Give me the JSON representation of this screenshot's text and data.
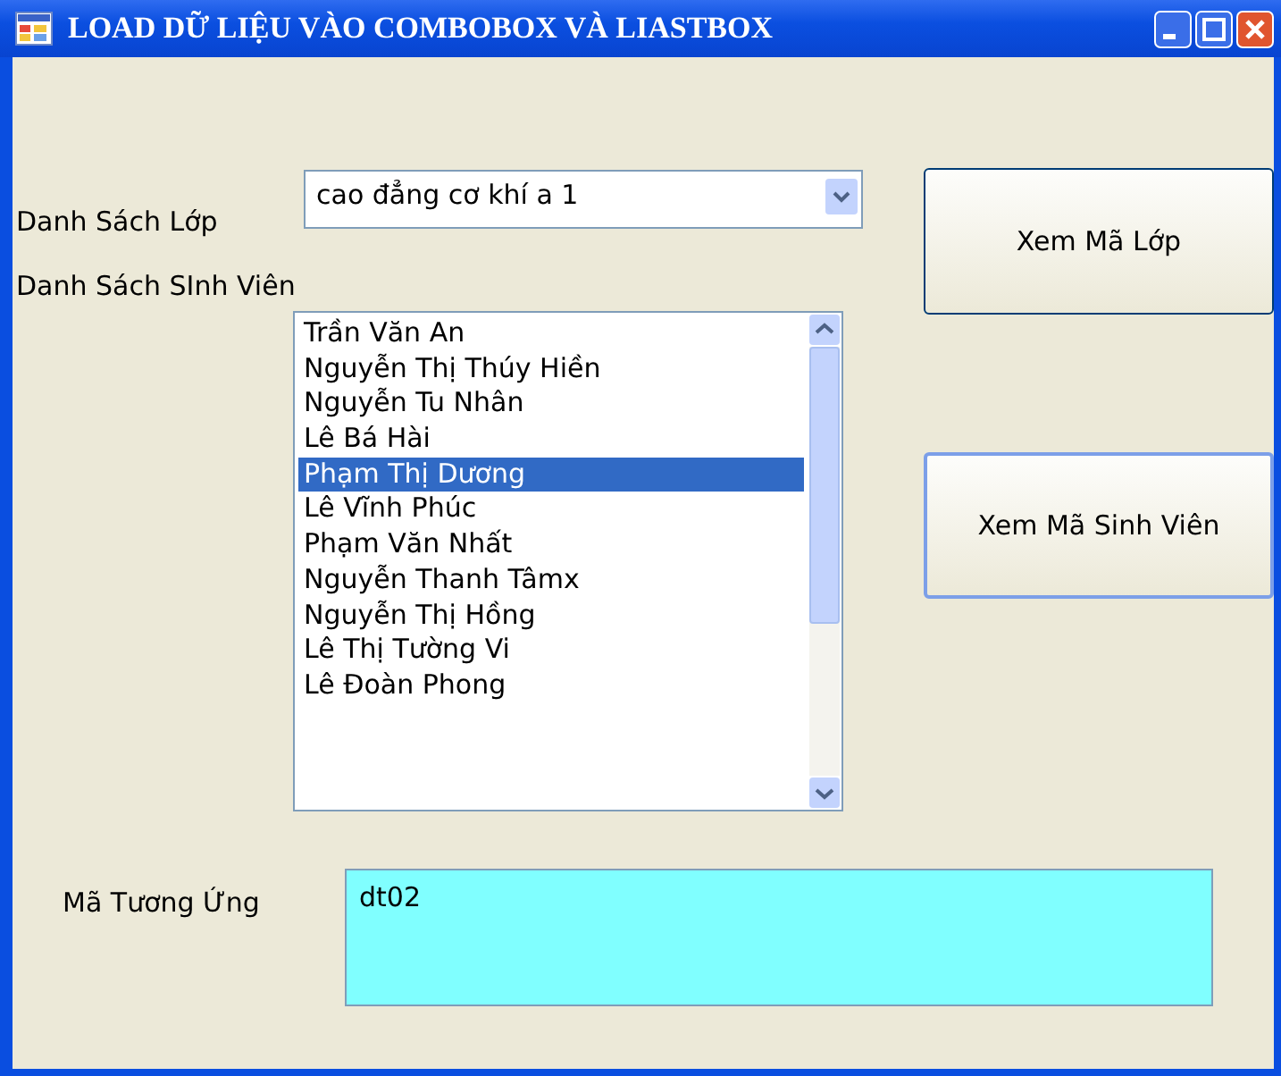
{
  "window": {
    "title": "LOAD DỮ LIỆU VÀO COMBOBOX VÀ LIASTBOX"
  },
  "class_label": "Danh Sách Lớp",
  "class_combo": {
    "value": "cao đẳng cơ khí a 1"
  },
  "class_button": "Xem Mã Lớp",
  "student_label": "Danh Sách SInh Viên",
  "students": [
    {
      "name": "Trần Văn An",
      "selected": false
    },
    {
      "name": "Nguyễn Thị Thúy Hiền",
      "selected": false
    },
    {
      "name": "Nguyễn Tu Nhân",
      "selected": false
    },
    {
      "name": "Lê Bá Hài",
      "selected": false
    },
    {
      "name": "Phạm Thị Dương",
      "selected": true
    },
    {
      "name": "Lê Vĩnh Phúc",
      "selected": false
    },
    {
      "name": "Phạm Văn Nhất",
      "selected": false
    },
    {
      "name": "Nguyễn Thanh Tâmx",
      "selected": false
    },
    {
      "name": "Nguyễn Thị Hồng",
      "selected": false
    },
    {
      "name": "Lê Thị Tường Vi",
      "selected": false
    },
    {
      "name": "Lê Đoàn Phong",
      "selected": false
    }
  ],
  "student_button": "Xem Mã Sinh Viên",
  "code_label": "Mã Tương Ứng",
  "code_box": {
    "value": "dt02"
  }
}
